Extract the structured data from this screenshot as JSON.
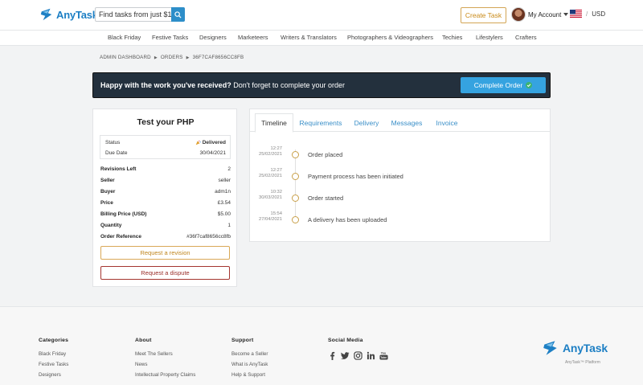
{
  "header": {
    "brand": "AnyTask",
    "search_placeholder": "Find tasks from just $1",
    "create_task": "Create Task",
    "account_label": "My Account",
    "currency": "USD"
  },
  "categories": [
    "Black Friday",
    "Festive Tasks",
    "Designers",
    "Marketeers",
    "Writers & Translators",
    "Photographers & Videographers",
    "Techies",
    "Lifestylers",
    "Crafters"
  ],
  "breadcrumb": [
    "ADMIN DASHBOARD",
    "ORDERS",
    "36F7CAF8656CC8FB"
  ],
  "banner": {
    "bold_text": "Happy with the work you've received?",
    "text": " Don't forget to complete your order",
    "button": "Complete Order"
  },
  "order": {
    "title": "Test your PHP",
    "status_label": "Status",
    "status_value": "Delivered",
    "due_label": "Due Date",
    "due_value": "30/04/2021",
    "details": [
      {
        "key": "Revisions Left",
        "value": "2"
      },
      {
        "key": "Seller",
        "value": "seller"
      },
      {
        "key": "Buyer",
        "value": "adm1n"
      },
      {
        "key": "Price",
        "value": "£3.54"
      },
      {
        "key": "Billing Price (USD)",
        "value": "$5.00"
      },
      {
        "key": "Quantity",
        "value": "1"
      },
      {
        "key": "Order Reference",
        "value": "#36f7caf8656cc8fb"
      }
    ],
    "revision_button": "Request a revision",
    "dispute_button": "Request a dispute"
  },
  "tabs": [
    "Timeline",
    "Requirements",
    "Delivery",
    "Messages",
    "Invoice"
  ],
  "timeline": [
    {
      "time": "12:27",
      "date": "25/02/2021",
      "text": "Order placed"
    },
    {
      "time": "12:27",
      "date": "25/02/2021",
      "text": "Payment process has been initiated"
    },
    {
      "time": "10:32",
      "date": "30/03/2021",
      "text": "Order started"
    },
    {
      "time": "15:54",
      "date": "27/04/2021",
      "text": "A delivery has been uploaded"
    }
  ],
  "footer": {
    "categories_title": "Categories",
    "categories": [
      "Black Friday",
      "Festive Tasks",
      "Designers"
    ],
    "about_title": "About",
    "about": [
      "Meet The Sellers",
      "News",
      "Intellectual Property Claims"
    ],
    "support_title": "Support",
    "support": [
      "Become a Seller",
      "What is AnyTask",
      "Help & Support"
    ],
    "social_title": "Social Media",
    "social_icons": [
      "facebook-icon",
      "twitter-icon",
      "instagram-icon",
      "linkedin-icon",
      "youtube-icon"
    ],
    "brand": "AnyTask",
    "tagline": "AnyTask™ Platform"
  },
  "colors": {
    "brand_blue": "#1d7fc4",
    "accent_gold": "#c98a18",
    "banner_bg": "#23303d",
    "complete_btn": "#35a3e0",
    "dispute_red": "#9a2d28"
  }
}
